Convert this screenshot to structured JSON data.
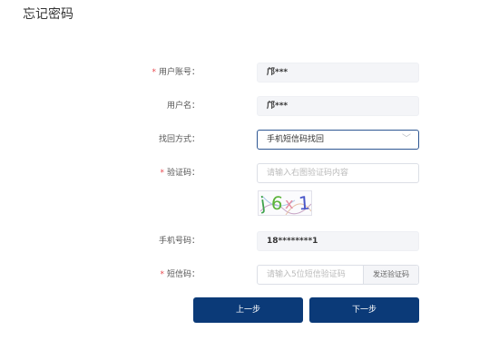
{
  "page": {
    "title": "忘记密码"
  },
  "form": {
    "account": {
      "label": "用户账号：",
      "value": "邝***",
      "required": true
    },
    "username": {
      "label": "用户名：",
      "value": "邝***"
    },
    "method": {
      "label": "找回方式：",
      "value": "手机短信码找回"
    },
    "captcha": {
      "label": "验证码：",
      "placeholder": "请输入右图验证码内容",
      "image_text": [
        "j",
        "6",
        "x",
        "1"
      ],
      "required": true
    },
    "phone": {
      "label": "手机号码：",
      "value": "18********1"
    },
    "sms": {
      "label": "短信码：",
      "placeholder": "请输入5位短信验证码",
      "send_label": "发送验证码",
      "required": true
    }
  },
  "buttons": {
    "prev": "上一步",
    "next": "下一步"
  },
  "colors": {
    "primary": "#0b3a78",
    "required": "#e8484d",
    "select_border": "#2d5693"
  }
}
